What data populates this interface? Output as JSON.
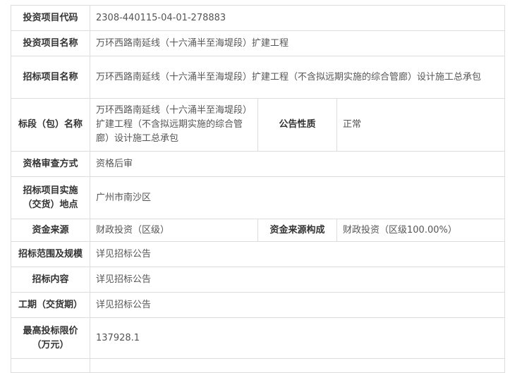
{
  "rows": {
    "investment_code": {
      "label": "投资项目代码",
      "value": "2308-440115-04-01-278883"
    },
    "investment_name": {
      "label": "投资项目名称",
      "value": "万环西路南延线（十六涌半至海堤段）扩建工程"
    },
    "tender_project_name": {
      "label": "招标项目名称",
      "value": "万环西路南延线（十六涌半至海堤段）扩建工程（不含拟远期实施的综合管廊）设计施工总承包"
    },
    "section_name": {
      "label": "标段（包）名称",
      "value": "万环西路南延线（十六涌半至海堤段）扩建工程（不含拟远期实施的综合管廊）设计施工总承包",
      "side_label": "公告性质",
      "side_value": "正常"
    },
    "qualification_review": {
      "label": "资格审查方式",
      "value": "资格后审"
    },
    "location": {
      "label": "招标项目实施（交货）地点",
      "value": "广州市南沙区"
    },
    "funding_source": {
      "label": "资金来源",
      "value": "财政投资（区级）",
      "side_label": "资金来源构成",
      "side_value": "财政投资（区级100.00%）"
    },
    "scope": {
      "label": "招标范围及规模",
      "value": "详见招标公告"
    },
    "content": {
      "label": "招标内容",
      "value": "详见招标公告"
    },
    "duration": {
      "label": "工期（交货期）",
      "value": "详见招标公告"
    },
    "max_price": {
      "label": "最高投标限价（万元）",
      "value": "137928.1"
    }
  }
}
